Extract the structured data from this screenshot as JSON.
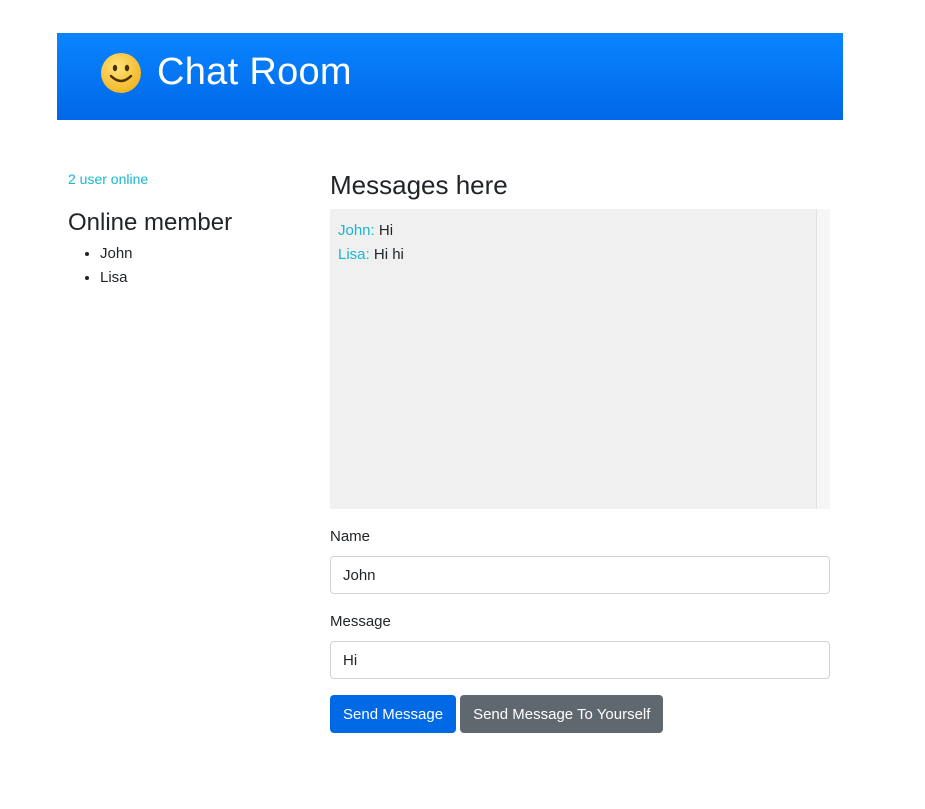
{
  "header": {
    "title": "Chat Room",
    "icon": "smiley-icon",
    "colors": {
      "background": "#0a7bff",
      "text": "#ffffff"
    }
  },
  "sidebar": {
    "online_count": "2 user online",
    "members_heading": "Online member",
    "members": [
      "John",
      "Lisa"
    ]
  },
  "main": {
    "messages_heading": "Messages here",
    "messages": [
      {
        "sender": "John:",
        "text": "Hi"
      },
      {
        "sender": "Lisa:",
        "text": "Hi hi"
      }
    ],
    "form": {
      "name_label": "Name",
      "name_value": "John",
      "message_label": "Message",
      "message_value": "Hi",
      "send_button": "Send Message",
      "send_self_button": "Send Message To Yourself"
    }
  },
  "colors": {
    "accent_cyan": "#17b7d0",
    "primary_button": "#0069e6",
    "secondary_button": "#5f676f",
    "messages_background": "#f0f0f0"
  }
}
